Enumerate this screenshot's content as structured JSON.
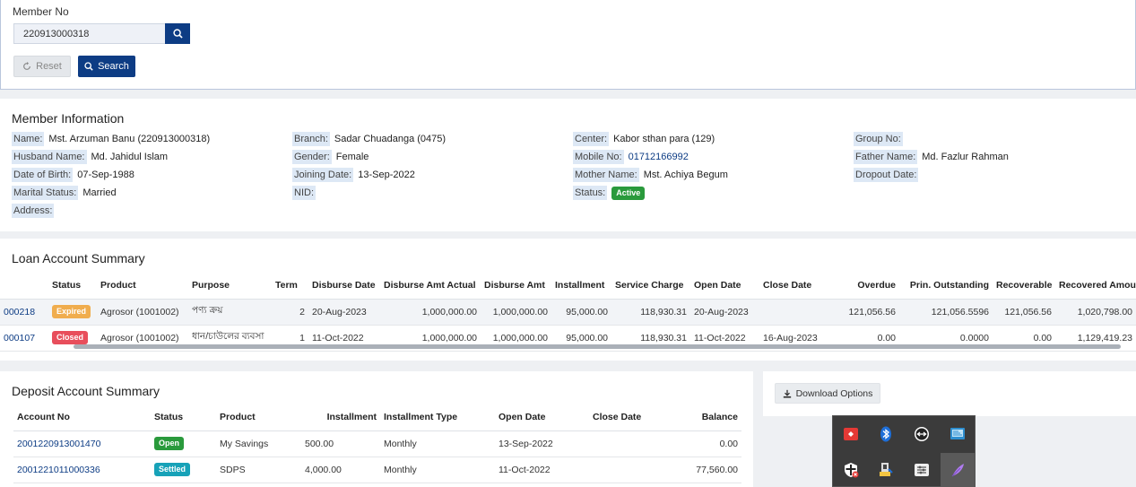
{
  "search": {
    "label": "Member No",
    "member_no": "220913000318",
    "reset_label": "Reset",
    "search_label": "Search"
  },
  "member_info": {
    "title": "Member Information",
    "name_k": "Name:",
    "name_v": "Mst. Arzuman Banu (220913000318)",
    "husband_k": "Husband Name:",
    "husband_v": "Md. Jahidul Islam",
    "dob_k": "Date of Birth:",
    "dob_v": "07-Sep-1988",
    "marital_k": "Marital Status:",
    "marital_v": "Married",
    "address_k": "Address:",
    "branch_k": "Branch:",
    "branch_v": "Sadar Chuadanga (0475)",
    "gender_k": "Gender:",
    "gender_v": "Female",
    "joining_k": "Joining Date:",
    "joining_v": "13-Sep-2022",
    "nid_k": "NID:",
    "center_k": "Center:",
    "center_v": "Kabor sthan para (129)",
    "mobile_k": "Mobile No:",
    "mobile_v": "01712166992",
    "mother_k": "Mother Name:",
    "mother_v": "Mst. Achiya Begum",
    "status_k": "Status:",
    "status_v": "Active",
    "group_k": "Group No:",
    "father_k": "Father Name:",
    "father_v": "Md. Fazlur Rahman",
    "dropout_k": "Dropout Date:"
  },
  "loan": {
    "title": "Loan Account Summary",
    "headers": [
      "Status",
      "Product",
      "Purpose",
      "Term",
      "Disburse Date",
      "Disburse Amt Actual",
      "Disburse Amt",
      "Installment",
      "Service Charge",
      "Open Date",
      "Close Date",
      "Overdue",
      "Prin. Outstanding",
      "Recoverable",
      "Recovered Amount"
    ],
    "rows": [
      {
        "acc": "000218",
        "status": "Expired",
        "product": "Agrosor (1001002)",
        "purpose": "পণ্য ক্রয়",
        "term": "2",
        "disburse_date": "20-Aug-2023",
        "amt_actual": "1,000,000.00",
        "amt": "1,000,000.00",
        "installment": "95,000.00",
        "service": "118,930.31",
        "open": "20-Aug-2023",
        "close": "",
        "overdue": "121,056.56",
        "prin": "121,056.5596",
        "recoverable": "121,056.56",
        "recovered": "1,020,798.00"
      },
      {
        "acc": "000107",
        "status": "Closed",
        "product": "Agrosor (1001002)",
        "purpose": "ধান/চাউলের ব্যবসা",
        "term": "1",
        "disburse_date": "11-Oct-2022",
        "amt_actual": "1,000,000.00",
        "amt": "1,000,000.00",
        "installment": "95,000.00",
        "service": "118,930.31",
        "open": "11-Oct-2022",
        "close": "16-Aug-2023",
        "overdue": "0.00",
        "prin": "0.0000",
        "recoverable": "0.00",
        "recovered": "1,129,419.23"
      }
    ]
  },
  "deposit": {
    "title": "Deposit Account Summary",
    "headers": [
      "Account No",
      "Status",
      "Product",
      "Installment",
      "Installment Type",
      "Open Date",
      "Close Date",
      "Balance"
    ],
    "rows": [
      {
        "acc": "2001220913001470",
        "status": "Open",
        "product": "My Savings",
        "installment": "500.00",
        "type": "Monthly",
        "open": "13-Sep-2022",
        "close": "",
        "balance": "0.00"
      },
      {
        "acc": "2001221011000336",
        "status": "Settled",
        "product": "SDPS",
        "installment": "4,000.00",
        "type": "Monthly",
        "open": "11-Oct-2022",
        "close": "",
        "balance": "77,560.00"
      }
    ]
  },
  "download": {
    "label": "Download Options"
  },
  "tray_icons": [
    "anydesk-icon",
    "bluetooth-icon",
    "teamviewer-icon",
    "network-app-icon",
    "security-shield-icon",
    "usb-device-icon",
    "settings-panel-icon",
    "feather-app-icon"
  ]
}
